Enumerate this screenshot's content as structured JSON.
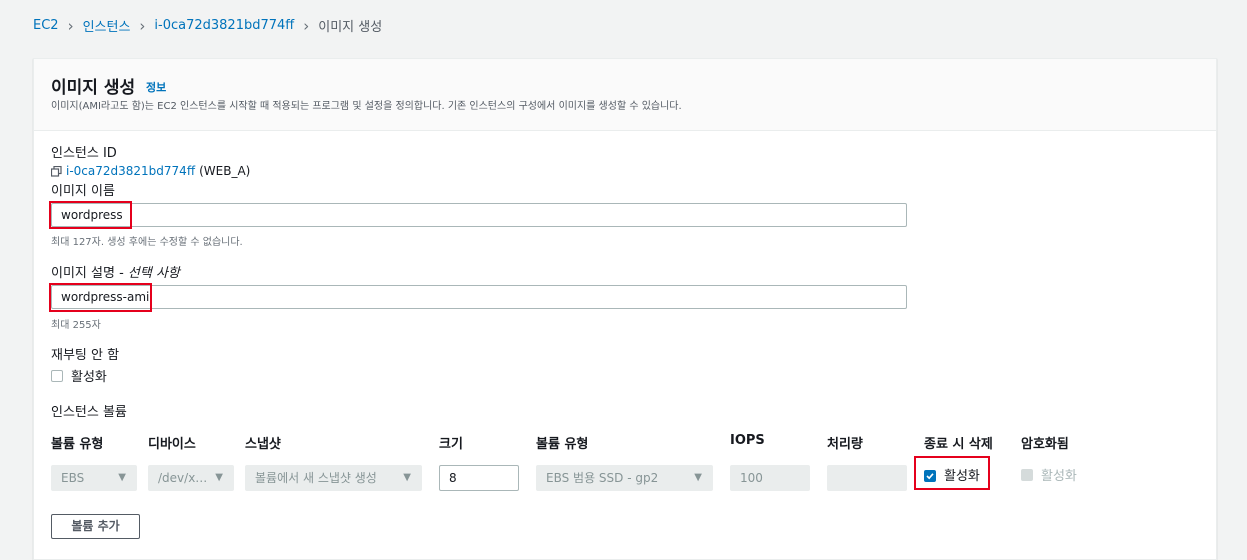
{
  "breadcrumb": {
    "items": [
      "EC2",
      "인스턴스",
      "i-0ca72d3821bd774ff"
    ],
    "current": "이미지 생성"
  },
  "panel": {
    "title": "이미지 생성",
    "info": "정보",
    "description": "이미지(AMI라고도 함)는 EC2 인스턴스를 시작할 때 적용되는 프로그램 및 설정을 정의합니다. 기존 인스턴스의 구성에서 이미지를 생성할 수 있습니다."
  },
  "instance": {
    "label": "인스턴스 ID",
    "id": "i-0ca72d3821bd774ff",
    "name": "(WEB_A)"
  },
  "image_name": {
    "label": "이미지 이름",
    "value": "wordpress",
    "hint": "최대 127자. 생성 후에는 수정할 수 없습니다."
  },
  "image_desc": {
    "label_main": "이미지 설명 - ",
    "label_optional": "선택 사항",
    "value": "wordpress-ami",
    "hint": "최대 255자"
  },
  "no_reboot": {
    "label": "재부팅 안 함",
    "checkbox_label": "활성화",
    "checked": false
  },
  "volumes": {
    "label": "인스턴스 볼륨",
    "headers": [
      "볼륨 유형",
      "디바이스",
      "스냅샷",
      "크기",
      "볼륨 유형",
      "IOPS",
      "처리량",
      "종료 시 삭제",
      "암호화됨"
    ],
    "row": {
      "volume_type": "EBS",
      "device": "/dev/x…",
      "snapshot": "볼륨에서 새 스냅샷 생성",
      "size": "8",
      "ebs_type": "EBS 범용 SSD - gp2",
      "iops": "100",
      "throughput": "",
      "delete_on_termination": "활성화",
      "encrypted": "활성화"
    },
    "add_button": "볼륨 추가"
  },
  "colors": {
    "link": "#0073bb",
    "highlight": "#e5001c",
    "background": "#f2f3f3"
  }
}
